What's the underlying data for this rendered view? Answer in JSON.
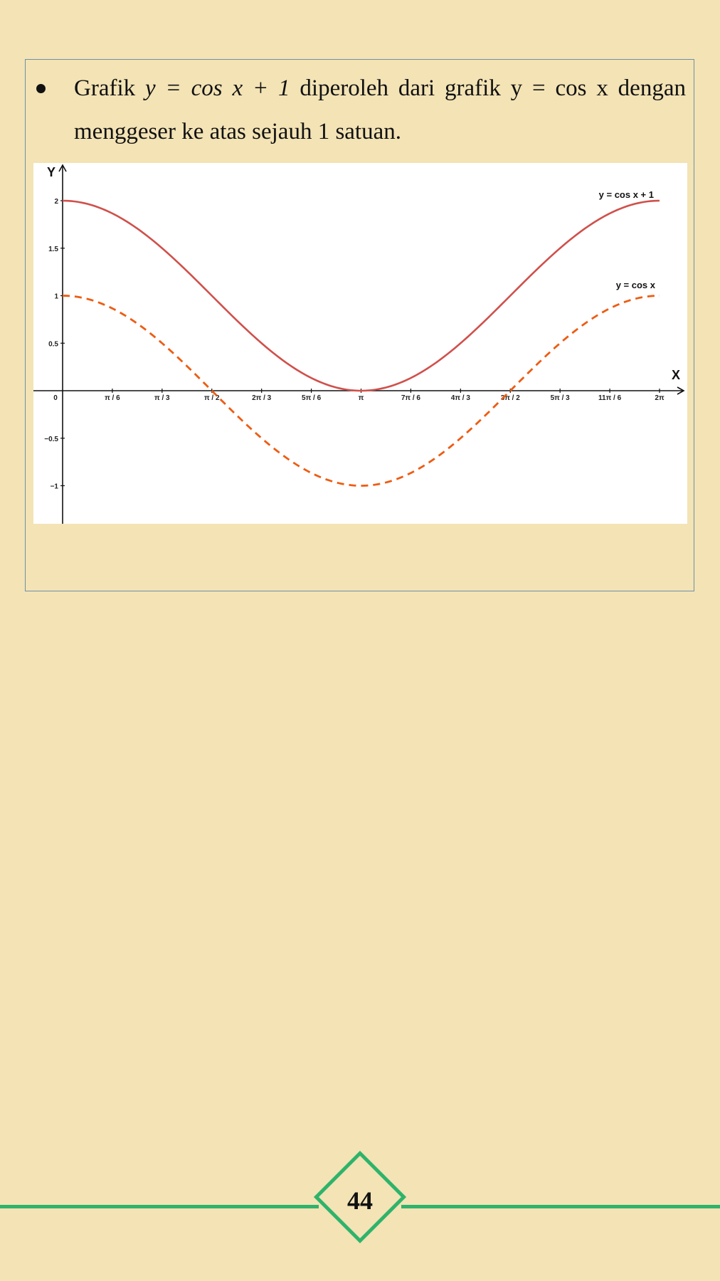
{
  "content": {
    "line1_prefix": "Grafik ",
    "line1_math": "y = cos x + 1",
    "line1_suffix": " diperoleh dari grafik y = cos x dengan",
    "line2": "menggeser ke atas sejauh 1 satuan."
  },
  "chart_data": {
    "type": "line",
    "xlabel": "X",
    "ylabel": "Y",
    "xlim": [
      0,
      6.2832
    ],
    "ylim": [
      -1.4,
      2.4
    ],
    "x_ticks": [
      {
        "value": 0,
        "label": "0"
      },
      {
        "value": 0.5236,
        "label": "π / 6"
      },
      {
        "value": 1.0472,
        "label": "π / 3"
      },
      {
        "value": 1.5708,
        "label": "π / 2"
      },
      {
        "value": 2.0944,
        "label": "2π / 3"
      },
      {
        "value": 2.618,
        "label": "5π / 6"
      },
      {
        "value": 3.1416,
        "label": "π"
      },
      {
        "value": 3.6652,
        "label": "7π / 6"
      },
      {
        "value": 4.1888,
        "label": "4π / 3"
      },
      {
        "value": 4.7124,
        "label": "3π / 2"
      },
      {
        "value": 5.236,
        "label": "5π / 3"
      },
      {
        "value": 5.7596,
        "label": "11π / 6"
      },
      {
        "value": 6.2832,
        "label": "2π"
      }
    ],
    "y_ticks": [
      {
        "value": 2,
        "label": "2"
      },
      {
        "value": 1.5,
        "label": "1.5"
      },
      {
        "value": 1,
        "label": "1"
      },
      {
        "value": 0.5,
        "label": "0.5"
      },
      {
        "value": -0.5,
        "label": "−0.5"
      },
      {
        "value": -1,
        "label": "−1"
      }
    ],
    "series": [
      {
        "name": "y = cos x + 1",
        "color": "#d0504b",
        "style": "solid",
        "x": [
          0,
          0.5236,
          1.0472,
          1.5708,
          2.0944,
          2.618,
          3.1416,
          3.6652,
          4.1888,
          4.7124,
          5.236,
          5.7596,
          6.2832
        ],
        "values": [
          2,
          1.866,
          1.5,
          1,
          0.5,
          0.134,
          0,
          0.134,
          0.5,
          1,
          1.5,
          1.866,
          2
        ]
      },
      {
        "name": "y = cos x",
        "color": "#ee5c12",
        "style": "dashed",
        "x": [
          0,
          0.5236,
          1.0472,
          1.5708,
          2.0944,
          2.618,
          3.1416,
          3.6652,
          4.1888,
          4.7124,
          5.236,
          5.7596,
          6.2832
        ],
        "values": [
          1,
          0.866,
          0.5,
          0,
          -0.5,
          -0.866,
          -1,
          -0.866,
          -0.5,
          0,
          0.5,
          0.866,
          1
        ]
      }
    ]
  },
  "footer": {
    "page_number": "44",
    "accent_color": "#2fb36b"
  }
}
